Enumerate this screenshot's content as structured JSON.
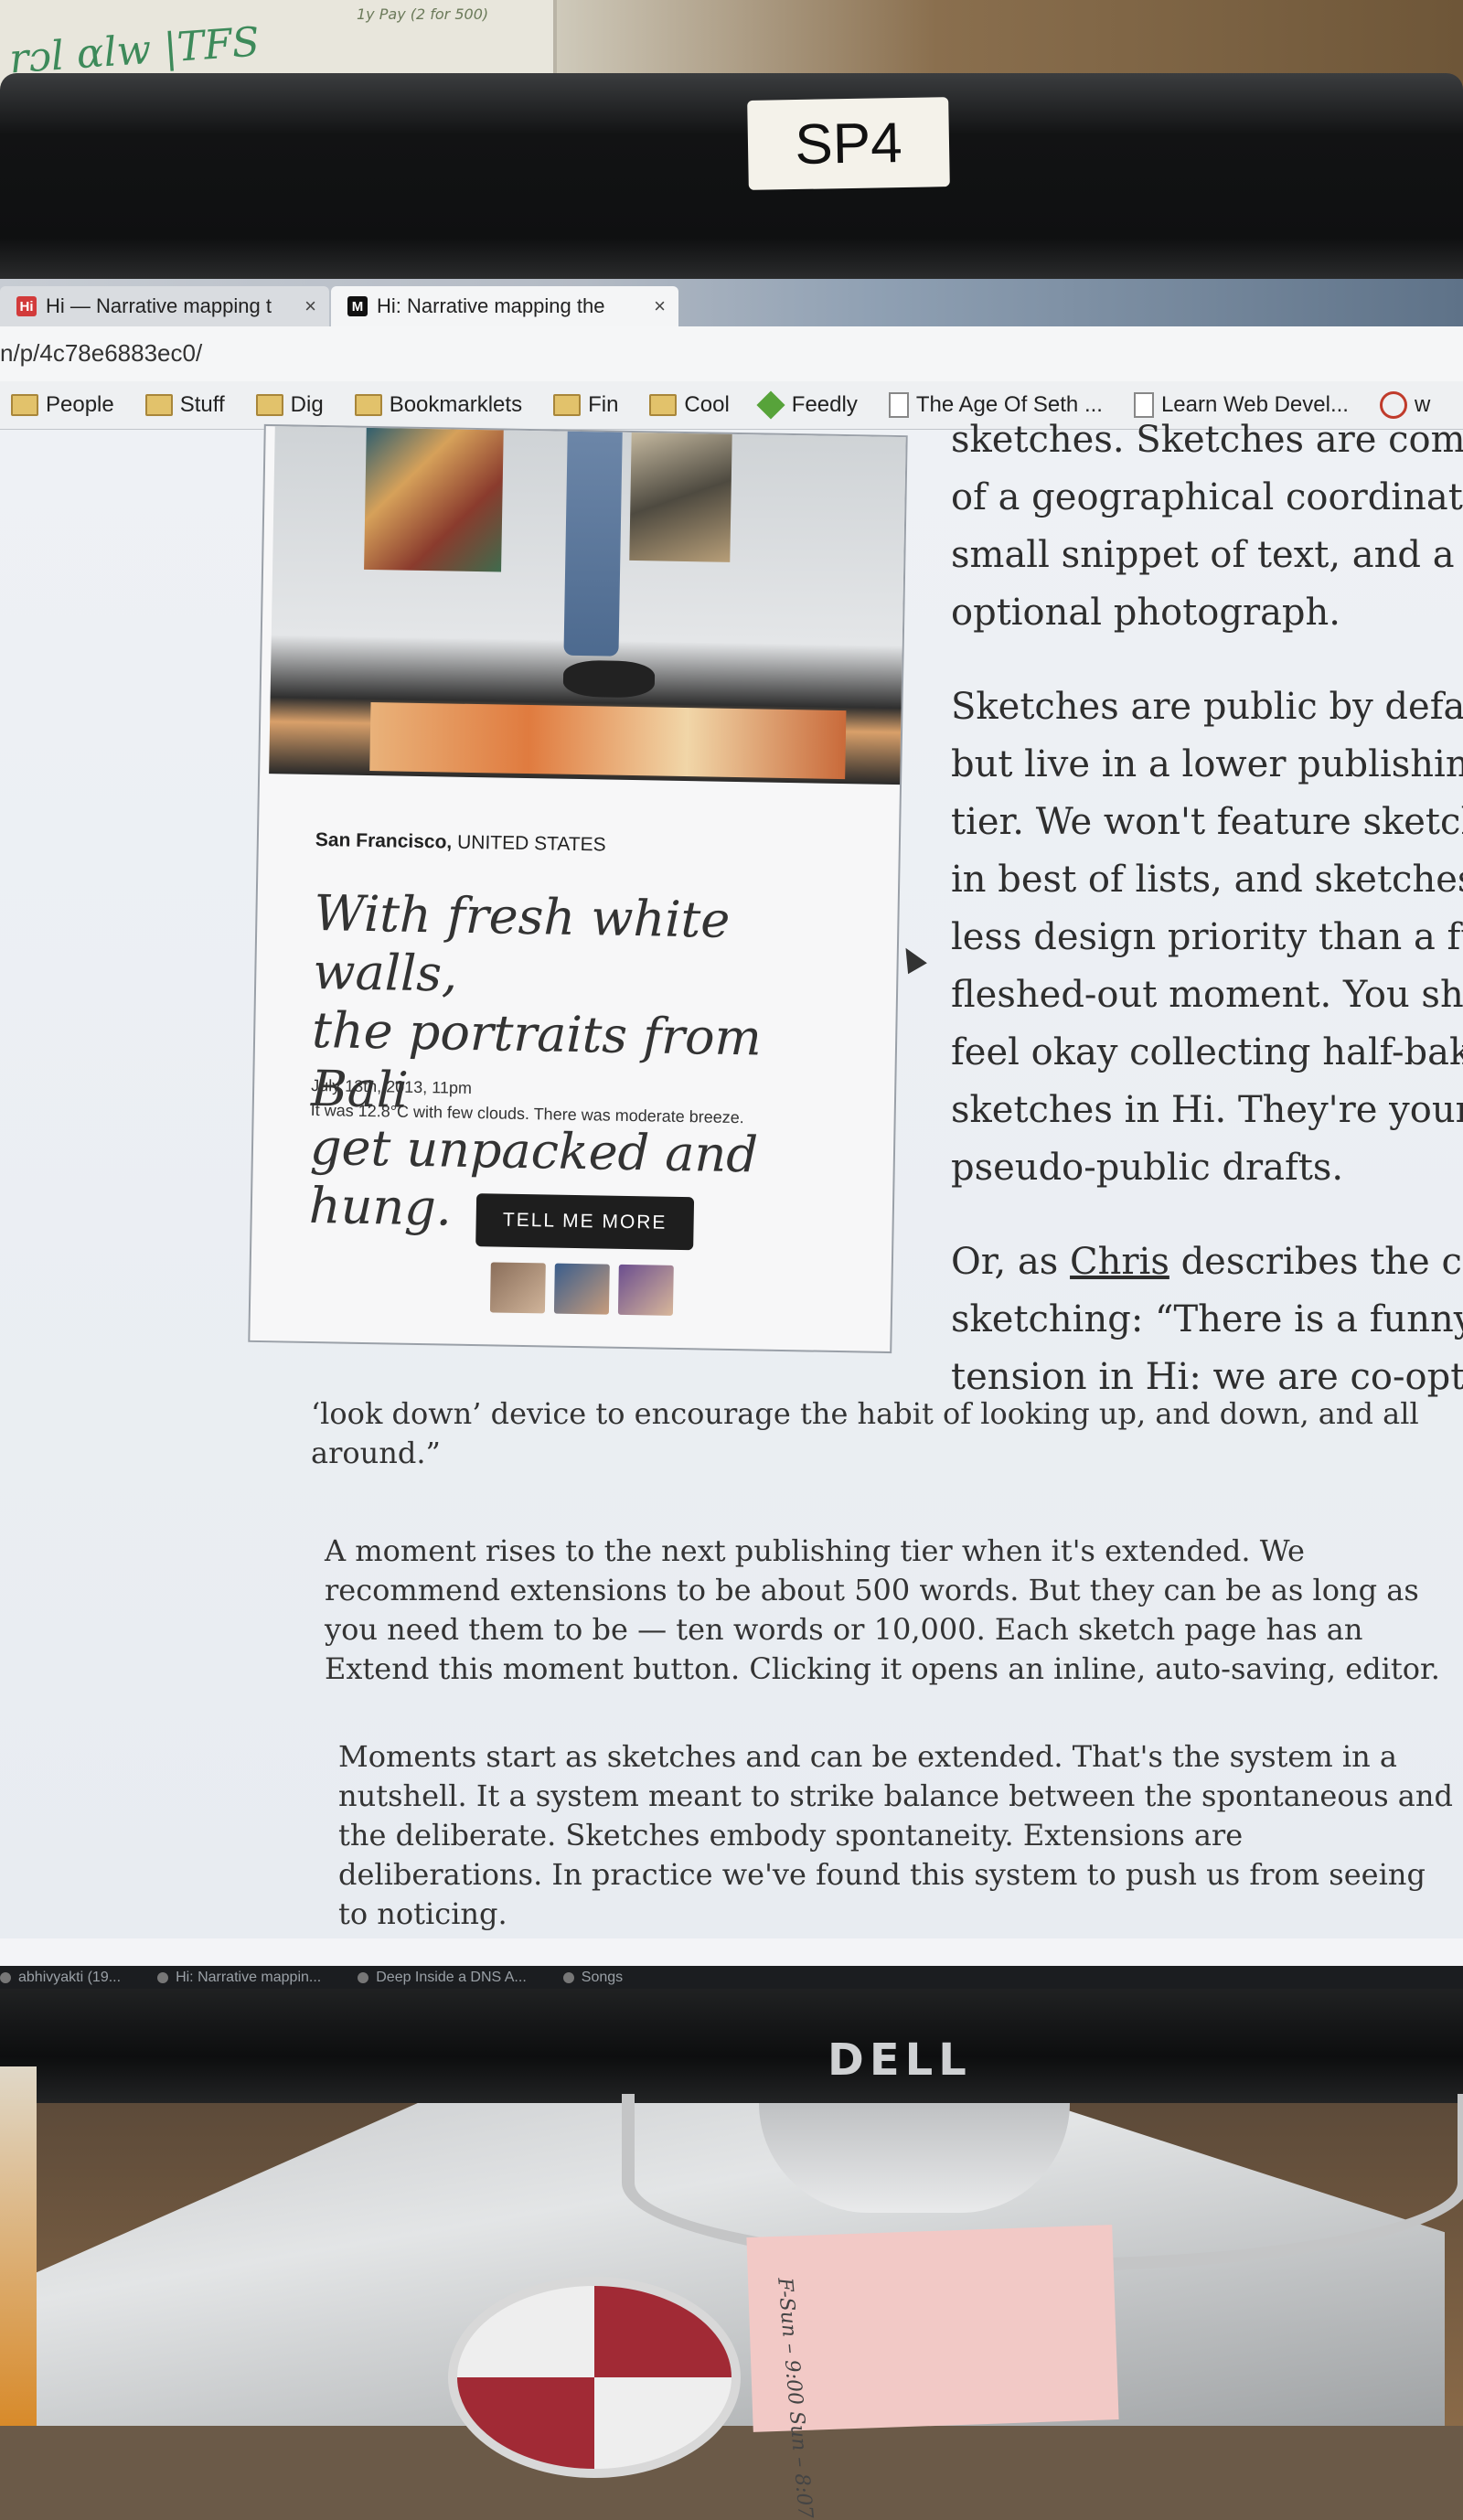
{
  "scene": {
    "whiteboard_scribble": "rɔl ɑlw |TFS",
    "whiteboard_note": "1y Pay (2 for 500)",
    "monitor_label": "SP4",
    "monitor_brand": "DELL",
    "sticky_note": "F-Sun – 9:00  Sun – 8:07"
  },
  "browser": {
    "tabs": [
      {
        "title": "Hi — Narrative mapping t",
        "active": false,
        "icon": "hi-logo-icon"
      },
      {
        "title": "Hi: Narrative mapping the",
        "active": true,
        "icon": "medium-logo-icon"
      }
    ],
    "url": "n/p/4c78e6883ec0/",
    "bookmarks": [
      {
        "label": "People",
        "icon": "folder-icon"
      },
      {
        "label": "Stuff",
        "icon": "folder-icon"
      },
      {
        "label": "Dig",
        "icon": "folder-icon"
      },
      {
        "label": "Bookmarklets",
        "icon": "folder-icon"
      },
      {
        "label": "Fin",
        "icon": "folder-icon"
      },
      {
        "label": "Cool",
        "icon": "folder-icon"
      },
      {
        "label": "Feedly",
        "icon": "feedly-icon"
      },
      {
        "label": "The Age Of Seth ...",
        "icon": "page-icon"
      },
      {
        "label": "Learn Web Devel...",
        "icon": "page-icon"
      },
      {
        "label": "w",
        "icon": "g-icon"
      }
    ]
  },
  "card": {
    "city": "San Francisco,",
    "country": "UNITED STATES",
    "headline_lines": [
      "With fresh white walls,",
      "the portraits from Bali",
      "get unpacked and hung."
    ],
    "date": "July 13th, 2013, 11pm",
    "weather": "It was 12.8°C with few clouds. There was moderate breeze.",
    "button": "TELL ME MORE"
  },
  "article": {
    "right_column": [
      [
        "sketches. Sketches are com",
        "of a geographical coordinat",
        "small snippet of text, and a",
        "optional photograph."
      ],
      [
        "Sketches are public by defau",
        "but live in a lower publishing",
        "tier. We won't feature sketche",
        "in best of lists, and sketches g",
        "less design priority than a full",
        "fleshed-out moment. You shou",
        "feel okay collecting half-baked",
        "sketches in Hi. They're your",
        "pseudo-public drafts."
      ]
    ],
    "para3_lines": [
      "Or, as ",
      "Chris",
      " describes the crux o",
      "sketching: “There is a funny",
      "tension in Hi: we are co-opting a"
    ],
    "para3_tail": "‘look down’ device to encourage the habit of looking up, and down, and all around.”",
    "para4": "A moment rises to the next publishing tier when it's extended. We recommend extensions to be about 500 words. But they can be as long as you need them to be — ten words or 10,000. Each sketch page has an Extend this moment button. Clicking it opens an inline, auto-saving, editor.",
    "para5": "Moments start as sketches and can be extended. That's the system in a nutshell. It a system meant to strike balance between the spontaneous and the deliberate. Sketches embody spontaneity. Extensions are deliberations. In practice we've found this system to push us from seeing to noticing."
  },
  "taskbar": {
    "items": [
      "abhivyakti (19...",
      "Hi: Narrative mappin...",
      "Deep Inside a DNS A...",
      "Songs"
    ]
  }
}
